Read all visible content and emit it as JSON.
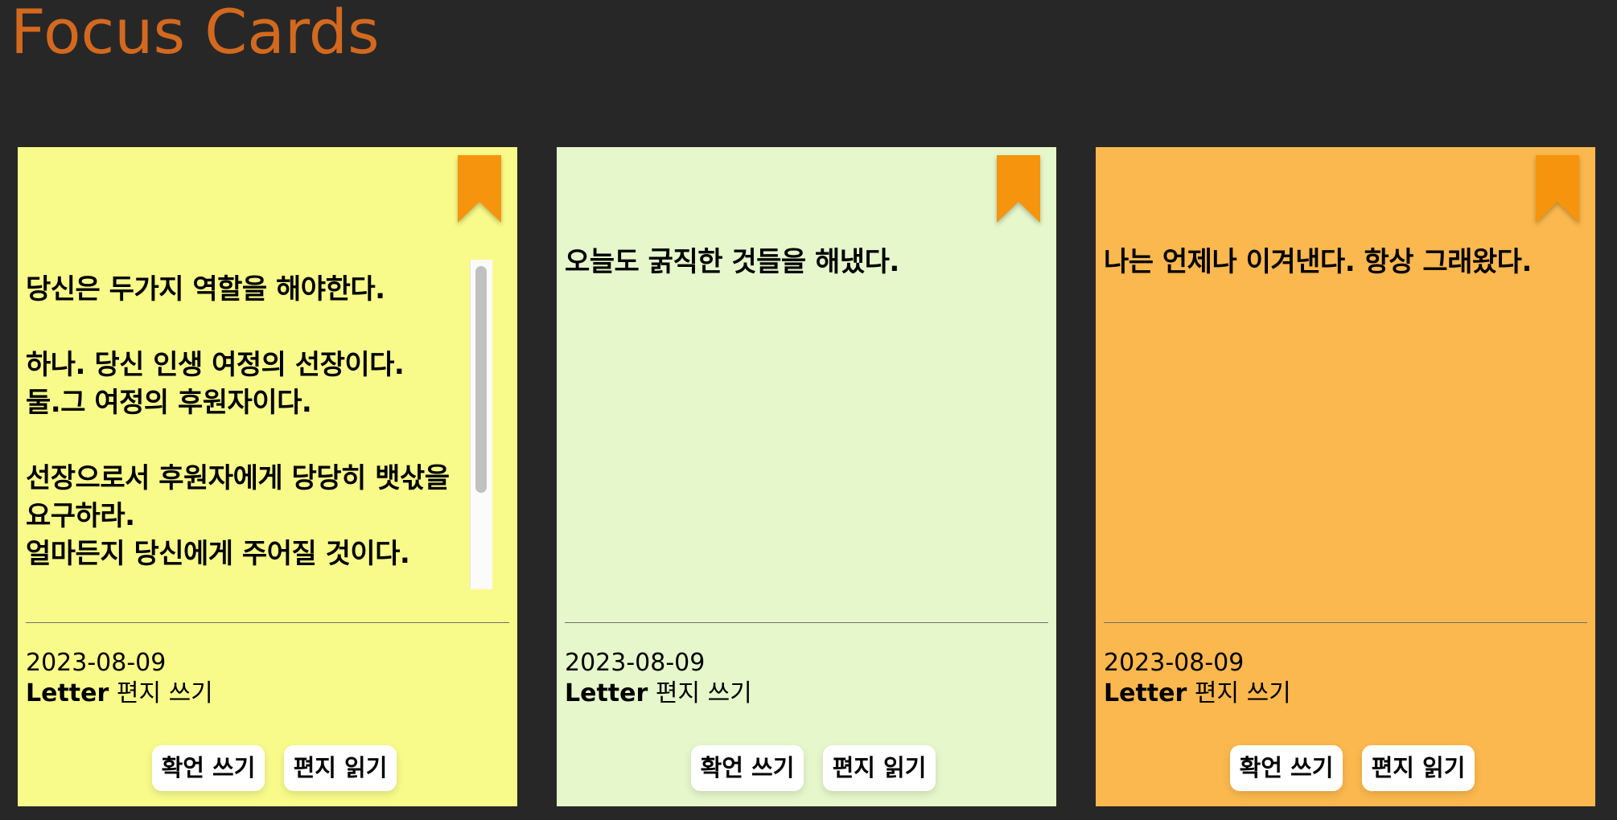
{
  "page": {
    "title": "Focus Cards",
    "title_color": "#d2691e",
    "background_color": "#272727"
  },
  "bookmark_color": "#f7940e",
  "cards": [
    {
      "background_color": "#f8fb8a",
      "message": "당신은 두가지 역할을 해야한다.\n\n하나. 당신 인생 여정의 선장이다.\n둘.그 여정의 후원자이다.\n\n선장으로서 후원자에게 당당히 뱃삯을 요구하라.\n얼마든지 당신에게 주어질 것이다.",
      "date": "2023-08-09",
      "letter_keyword": "Letter",
      "letter_label": "편지 쓰기",
      "reply_button": "확언 쓰기",
      "read_button": "편지 읽기"
    },
    {
      "background_color": "#e5f7cb",
      "message": "오늘도 굵직한 것들을 해냈다.",
      "date": "2023-08-09",
      "letter_keyword": "Letter",
      "letter_label": "편지 쓰기",
      "reply_button": "확언 쓰기",
      "read_button": "편지 읽기"
    },
    {
      "background_color": "#fbb84e",
      "message": "나는 언제나 이겨낸다. 항상 그래왔다.",
      "date": "2023-08-09",
      "letter_keyword": "Letter",
      "letter_label": "편지 쓰기",
      "reply_button": "확언 쓰기",
      "read_button": "편지 읽기"
    }
  ]
}
